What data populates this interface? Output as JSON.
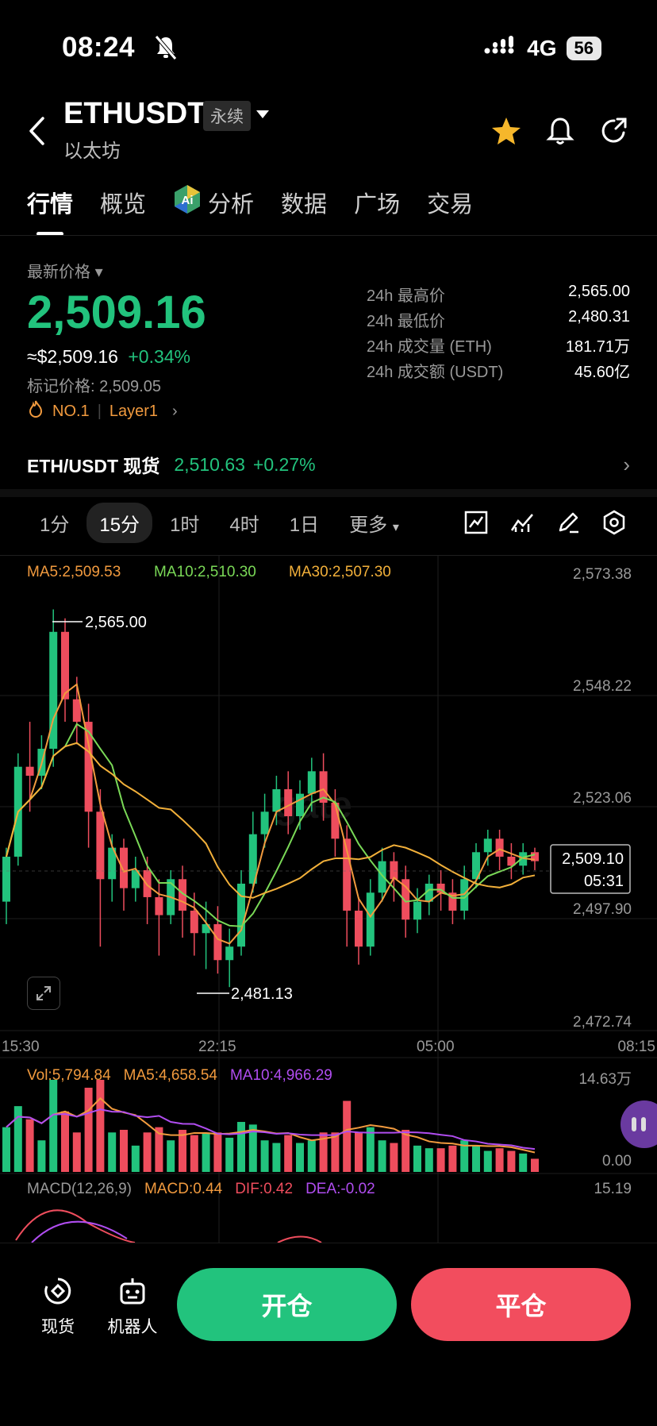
{
  "status": {
    "time": "08:24",
    "network": "4G",
    "battery": "56"
  },
  "header": {
    "symbol": "ETHUSDT",
    "badge": "永续",
    "name": "以太坊"
  },
  "tabs": [
    "行情",
    "概览",
    "分析",
    "数据",
    "广场",
    "交易"
  ],
  "price": {
    "label": "最新价格",
    "last": "2,509.16",
    "usd": "≈$2,509.16",
    "change": "+0.34%",
    "mark_label": "标记价格: 2,509.05",
    "rank": "NO.1",
    "tag": "Layer1"
  },
  "stats": [
    {
      "k": "24h 最高价",
      "v": "2,565.00"
    },
    {
      "k": "24h 最低价",
      "v": "2,480.31"
    },
    {
      "k": "24h 成交量 (ETH)",
      "v": "181.71万"
    },
    {
      "k": "24h 成交额 (USDT)",
      "v": "45.60亿"
    }
  ],
  "spot": {
    "label": "ETH/USDT 现货",
    "price": "2,510.63",
    "change": "+0.27%"
  },
  "timeframes": [
    "1分",
    "15分",
    "1时",
    "4时",
    "1日",
    "更多"
  ],
  "timeframe_active": "15分",
  "ma": {
    "ma5": "MA5:2,509.53",
    "ma10": "MA10:2,510.30",
    "ma30": "MA30:2,507.30"
  },
  "price_axis": [
    "2,573.38",
    "2,548.22",
    "2,523.06",
    "2,497.90",
    "2,472.74"
  ],
  "markers": {
    "high": "2,565.00",
    "low": "2,481.13",
    "current": "2,509.10",
    "countdown": "05:31"
  },
  "time_axis": [
    "15:30",
    "22:15",
    "05:00",
    "08:15"
  ],
  "volume": {
    "vol": "Vol:5,794.84",
    "ma5": "MA5:4,658.54",
    "ma10": "MA10:4,966.29",
    "max": "14.63万",
    "min": "0.00"
  },
  "macd": {
    "label": "MACD(12,26,9)",
    "macd": "MACD:0.44",
    "dif": "DIF:0.42",
    "dea": "DEA:-0.02",
    "max": "15.19"
  },
  "bottom": {
    "spot": "现货",
    "robot": "机器人",
    "open": "开仓",
    "close": "平仓"
  },
  "colors": {
    "up": "#22c37d",
    "down": "#ee4d5d",
    "ma5": "#f19a3e",
    "ma10": "#7ad957",
    "ma30": "#f2b03a",
    "purple": "#b04df0"
  },
  "chart_data": {
    "type": "candlestick",
    "price_range": [
      2472.74,
      2573.38
    ],
    "high": 2565.0,
    "low": 2481.13,
    "last": 2509.1,
    "candles": [
      [
        2500,
        2510,
        2495,
        2512
      ],
      [
        2510,
        2530,
        2508,
        2533
      ],
      [
        2530,
        2528,
        2520,
        2540
      ],
      [
        2528,
        2534,
        2525,
        2537
      ],
      [
        2534,
        2560,
        2530,
        2565
      ],
      [
        2560,
        2545,
        2540,
        2563
      ],
      [
        2545,
        2540,
        2535,
        2550
      ],
      [
        2540,
        2520,
        2512,
        2544
      ],
      [
        2520,
        2505,
        2490,
        2525
      ],
      [
        2505,
        2512,
        2500,
        2515
      ],
      [
        2512,
        2503,
        2498,
        2514
      ],
      [
        2503,
        2507,
        2500,
        2510
      ],
      [
        2507,
        2501,
        2495,
        2510
      ],
      [
        2501,
        2497,
        2488,
        2505
      ],
      [
        2497,
        2505,
        2495,
        2507
      ],
      [
        2505,
        2498,
        2492,
        2508
      ],
      [
        2498,
        2493,
        2488,
        2502
      ],
      [
        2493,
        2495,
        2485,
        2500
      ],
      [
        2495,
        2487,
        2484,
        2499
      ],
      [
        2487,
        2490,
        2481,
        2494
      ],
      [
        2490,
        2504,
        2488,
        2507
      ],
      [
        2504,
        2515,
        2502,
        2520
      ],
      [
        2515,
        2520,
        2512,
        2524
      ],
      [
        2520,
        2525,
        2517,
        2528
      ],
      [
        2525,
        2519,
        2515,
        2529
      ],
      [
        2519,
        2524,
        2516,
        2527
      ],
      [
        2524,
        2529,
        2520,
        2532
      ],
      [
        2529,
        2522,
        2518,
        2533
      ],
      [
        2522,
        2514,
        2510,
        2525
      ],
      [
        2514,
        2498,
        2490,
        2517
      ],
      [
        2498,
        2490,
        2486,
        2501
      ],
      [
        2490,
        2502,
        2488,
        2505
      ],
      [
        2502,
        2509,
        2500,
        2512
      ],
      [
        2509,
        2505,
        2500,
        2511
      ],
      [
        2505,
        2496,
        2492,
        2508
      ],
      [
        2496,
        2500,
        2493,
        2503
      ],
      [
        2500,
        2504,
        2497,
        2506
      ],
      [
        2504,
        2502,
        2498,
        2507
      ],
      [
        2502,
        2498,
        2495,
        2505
      ],
      [
        2498,
        2505,
        2496,
        2508
      ],
      [
        2505,
        2511,
        2503,
        2513
      ],
      [
        2511,
        2514,
        2508,
        2516
      ],
      [
        2514,
        2510,
        2507,
        2516
      ],
      [
        2510,
        2508,
        2505,
        2513
      ],
      [
        2508,
        2511,
        2506,
        2513
      ],
      [
        2511,
        2509,
        2507,
        2512
      ]
    ]
  }
}
